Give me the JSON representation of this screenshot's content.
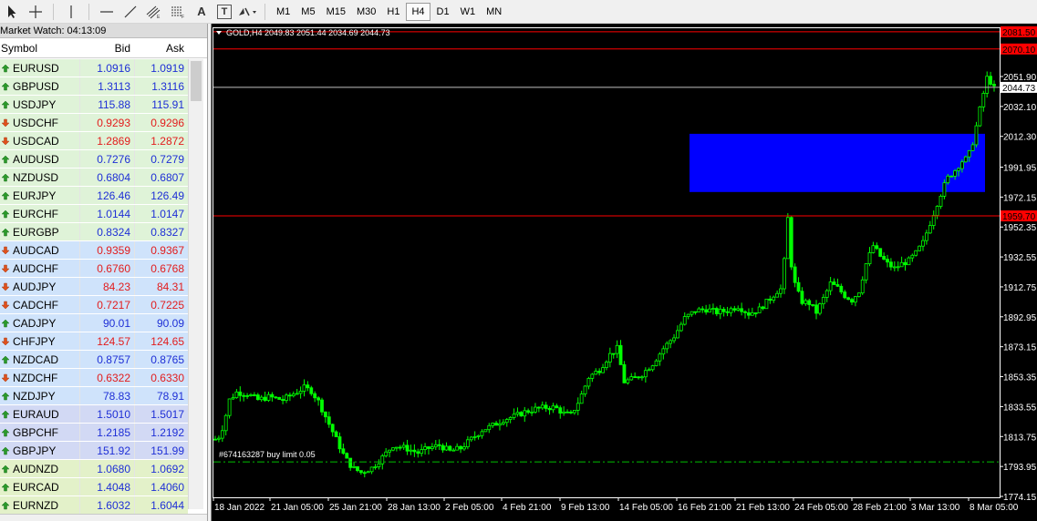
{
  "toolbar": {
    "tools": [
      {
        "name": "cursor-icon"
      },
      {
        "name": "crosshair-icon"
      },
      {
        "name": "vertical-line-icon"
      },
      {
        "name": "horizontal-line-icon"
      },
      {
        "name": "trendline-icon"
      },
      {
        "name": "equidistant-channel-icon"
      },
      {
        "name": "fibonacci-icon"
      },
      {
        "name": "text-icon"
      },
      {
        "name": "text-label-icon"
      },
      {
        "name": "arrows-icon"
      }
    ],
    "text_tool": "A",
    "label_tool": "T",
    "timeframes": [
      "M1",
      "M5",
      "M15",
      "M30",
      "H1",
      "H4",
      "D1",
      "W1",
      "MN"
    ],
    "active_timeframe": "H4"
  },
  "market_watch": {
    "title": "Market Watch: 04:13:09",
    "headers": {
      "symbol": "Symbol",
      "bid": "Bid",
      "ask": "Ask"
    },
    "rows": [
      {
        "symbol": "EURUSD",
        "bid": "1.0916",
        "ask": "1.0919",
        "dir": "up",
        "bg": "#dff3d8"
      },
      {
        "symbol": "GBPUSD",
        "bid": "1.3113",
        "ask": "1.3116",
        "dir": "up",
        "bg": "#dff3d8"
      },
      {
        "symbol": "USDJPY",
        "bid": "115.88",
        "ask": "115.91",
        "dir": "up",
        "bg": "#dff3d8"
      },
      {
        "symbol": "USDCHF",
        "bid": "0.9293",
        "ask": "0.9296",
        "dir": "down",
        "bg": "#dff3d8"
      },
      {
        "symbol": "USDCAD",
        "bid": "1.2869",
        "ask": "1.2872",
        "dir": "down",
        "bg": "#dff3d8"
      },
      {
        "symbol": "AUDUSD",
        "bid": "0.7276",
        "ask": "0.7279",
        "dir": "up",
        "bg": "#dff3d8"
      },
      {
        "symbol": "NZDUSD",
        "bid": "0.6804",
        "ask": "0.6807",
        "dir": "up",
        "bg": "#dff3d8"
      },
      {
        "symbol": "EURJPY",
        "bid": "126.46",
        "ask": "126.49",
        "dir": "up",
        "bg": "#dff3d8"
      },
      {
        "symbol": "EURCHF",
        "bid": "1.0144",
        "ask": "1.0147",
        "dir": "up",
        "bg": "#dff3d8"
      },
      {
        "symbol": "EURGBP",
        "bid": "0.8324",
        "ask": "0.8327",
        "dir": "up",
        "bg": "#dff3d8"
      },
      {
        "symbol": "AUDCAD",
        "bid": "0.9359",
        "ask": "0.9367",
        "dir": "down",
        "bg": "#cfe3fb"
      },
      {
        "symbol": "AUDCHF",
        "bid": "0.6760",
        "ask": "0.6768",
        "dir": "down",
        "bg": "#cfe3fb"
      },
      {
        "symbol": "AUDJPY",
        "bid": "84.23",
        "ask": "84.31",
        "dir": "down",
        "bg": "#cfe3fb"
      },
      {
        "symbol": "CADCHF",
        "bid": "0.7217",
        "ask": "0.7225",
        "dir": "down",
        "bg": "#cfe3fb"
      },
      {
        "symbol": "CADJPY",
        "bid": "90.01",
        "ask": "90.09",
        "dir": "up",
        "bg": "#cfe3fb"
      },
      {
        "symbol": "CHFJPY",
        "bid": "124.57",
        "ask": "124.65",
        "dir": "down",
        "bg": "#cfe3fb"
      },
      {
        "symbol": "NZDCAD",
        "bid": "0.8757",
        "ask": "0.8765",
        "dir": "up",
        "bg": "#cfe3fb"
      },
      {
        "symbol": "NZDCHF",
        "bid": "0.6322",
        "ask": "0.6330",
        "dir": "down",
        "bg": "#cfe3fb"
      },
      {
        "symbol": "NZDJPY",
        "bid": "78.83",
        "ask": "78.91",
        "dir": "up",
        "bg": "#cfe3fb"
      },
      {
        "symbol": "EURAUD",
        "bid": "1.5010",
        "ask": "1.5017",
        "dir": "up",
        "bg": "#d2d9f4"
      },
      {
        "symbol": "GBPCHF",
        "bid": "1.2185",
        "ask": "1.2192",
        "dir": "up",
        "bg": "#d2d9f4"
      },
      {
        "symbol": "GBPJPY",
        "bid": "151.92",
        "ask": "151.99",
        "dir": "up",
        "bg": "#d2d9f4"
      },
      {
        "symbol": "AUDNZD",
        "bid": "1.0680",
        "ask": "1.0692",
        "dir": "up",
        "bg": "#e3f1c9"
      },
      {
        "symbol": "EURCAD",
        "bid": "1.4048",
        "ask": "1.4060",
        "dir": "up",
        "bg": "#e3f1c9"
      },
      {
        "symbol": "EURNZD",
        "bid": "1.6032",
        "ask": "1.6044",
        "dir": "up",
        "bg": "#e3f1c9"
      }
    ]
  },
  "chart": {
    "header": "GOLD,H4  2049.83 2051.44 2034.69 2044.73",
    "order_label": "#674163287 buy limit 0.05",
    "colors": {
      "background": "#000000",
      "candles": "#00ff00",
      "axis_text": "#ffffff",
      "red_line": "#ff0000",
      "current_price_line": "#c0c0c0",
      "order_line": "#00c000",
      "rectangle": "#0000ff"
    }
  },
  "chart_data": {
    "type": "candlestick",
    "instrument": "GOLD",
    "timeframe": "H4",
    "ohlc_last": {
      "open": 2049.83,
      "high": 2051.44,
      "low": 2034.69,
      "close": 2044.73
    },
    "y_ticks": [
      "2051.90",
      "2032.10",
      "2012.30",
      "1991.95",
      "1972.15",
      "1952.35",
      "1932.55",
      "1912.75",
      "1892.95",
      "1873.15",
      "1853.35",
      "1833.55",
      "1813.75",
      "1793.95",
      "1774.15"
    ],
    "x_ticks": [
      "18 Jan 2022",
      "21 Jan 05:00",
      "25 Jan 21:00",
      "28 Jan 13:00",
      "2 Feb 05:00",
      "4 Feb 21:00",
      "9 Feb 13:00",
      "14 Feb 05:00",
      "16 Feb 21:00",
      "21 Feb 13:00",
      "24 Feb 05:00",
      "28 Feb 21:00",
      "3 Mar 13:00",
      "8 Mar 05:00"
    ],
    "ylim": [
      1774.15,
      2090
    ],
    "horizontal_lines": [
      {
        "price": 2081.5,
        "label": "2081.50",
        "kind": "red"
      },
      {
        "price": 2070.1,
        "label": "2070.10",
        "kind": "red"
      },
      {
        "price": 2044.73,
        "label": "2044.73",
        "kind": "current"
      },
      {
        "price": 1959.7,
        "label": "1959.70",
        "kind": "red"
      },
      {
        "price": 1797.0,
        "label": "",
        "kind": "order"
      }
    ],
    "zone": {
      "price_top": 2014.0,
      "price_bottom": 1975.5
    },
    "price_path": [
      [
        0,
        1812
      ],
      [
        0.6,
        1814
      ],
      [
        1.2,
        1822
      ],
      [
        2.0,
        1838
      ],
      [
        3.0,
        1843
      ],
      [
        4.5,
        1842
      ],
      [
        6.0,
        1838
      ],
      [
        7.5,
        1840
      ],
      [
        9.5,
        1838
      ],
      [
        11.0,
        1842
      ],
      [
        12.5,
        1846
      ],
      [
        13.5,
        1844
      ],
      [
        14.5,
        1837
      ],
      [
        15.8,
        1824
      ],
      [
        17.0,
        1812
      ],
      [
        18.2,
        1800
      ],
      [
        19.3,
        1793
      ],
      [
        20.5,
        1790
      ],
      [
        22.0,
        1793
      ],
      [
        23.5,
        1800
      ],
      [
        25.0,
        1808
      ],
      [
        26.8,
        1806
      ],
      [
        28.5,
        1803
      ],
      [
        30.0,
        1806
      ],
      [
        31.5,
        1808
      ],
      [
        33.0,
        1804
      ],
      [
        34.5,
        1806
      ],
      [
        36.0,
        1812
      ],
      [
        37.5,
        1818
      ],
      [
        39.0,
        1821
      ],
      [
        40.5,
        1825
      ],
      [
        42.0,
        1827
      ],
      [
        43.5,
        1830
      ],
      [
        45.0,
        1832
      ],
      [
        46.5,
        1833
      ],
      [
        47.8,
        1833
      ],
      [
        49.0,
        1829
      ],
      [
        50.0,
        1828
      ],
      [
        51.2,
        1838
      ],
      [
        52.5,
        1853
      ],
      [
        54.0,
        1858
      ],
      [
        55.5,
        1868
      ],
      [
        56.5,
        1872
      ],
      [
        57.5,
        1850
      ],
      [
        58.8,
        1852
      ],
      [
        60.0,
        1855
      ],
      [
        61.5,
        1862
      ],
      [
        63.0,
        1872
      ],
      [
        64.5,
        1880
      ],
      [
        66.0,
        1892
      ],
      [
        67.5,
        1897
      ],
      [
        69.0,
        1898
      ],
      [
        70.5,
        1896
      ],
      [
        72.0,
        1897
      ],
      [
        73.5,
        1900
      ],
      [
        75.0,
        1895
      ],
      [
        76.5,
        1898
      ],
      [
        78.0,
        1905
      ],
      [
        79.0,
        1910
      ],
      [
        79.8,
        1912
      ],
      [
        80.4,
        1965
      ],
      [
        80.9,
        1930
      ],
      [
        81.6,
        1912
      ],
      [
        82.5,
        1903
      ],
      [
        83.5,
        1902
      ],
      [
        84.5,
        1896
      ],
      [
        85.5,
        1905
      ],
      [
        86.5,
        1915
      ],
      [
        87.5,
        1912
      ],
      [
        88.5,
        1907
      ],
      [
        89.5,
        1904
      ],
      [
        90.5,
        1910
      ],
      [
        91.5,
        1928
      ],
      [
        92.5,
        1940
      ],
      [
        93.5,
        1933
      ],
      [
        94.5,
        1928
      ],
      [
        95.5,
        1925
      ],
      [
        96.5,
        1928
      ],
      [
        97.5,
        1930
      ],
      [
        98.5,
        1935
      ],
      [
        99.5,
        1942
      ],
      [
        100.5,
        1955
      ],
      [
        101.5,
        1968
      ],
      [
        102.3,
        1978
      ],
      [
        103.0,
        1985
      ],
      [
        104.0,
        1990
      ],
      [
        105.0,
        1996
      ],
      [
        105.8,
        1998
      ],
      [
        106.6,
        2010
      ],
      [
        107.4,
        2028
      ],
      [
        108.2,
        2045
      ],
      [
        108.7,
        2055
      ],
      [
        109.2,
        2044
      ]
    ],
    "x_range": [
      0,
      109.5
    ]
  }
}
